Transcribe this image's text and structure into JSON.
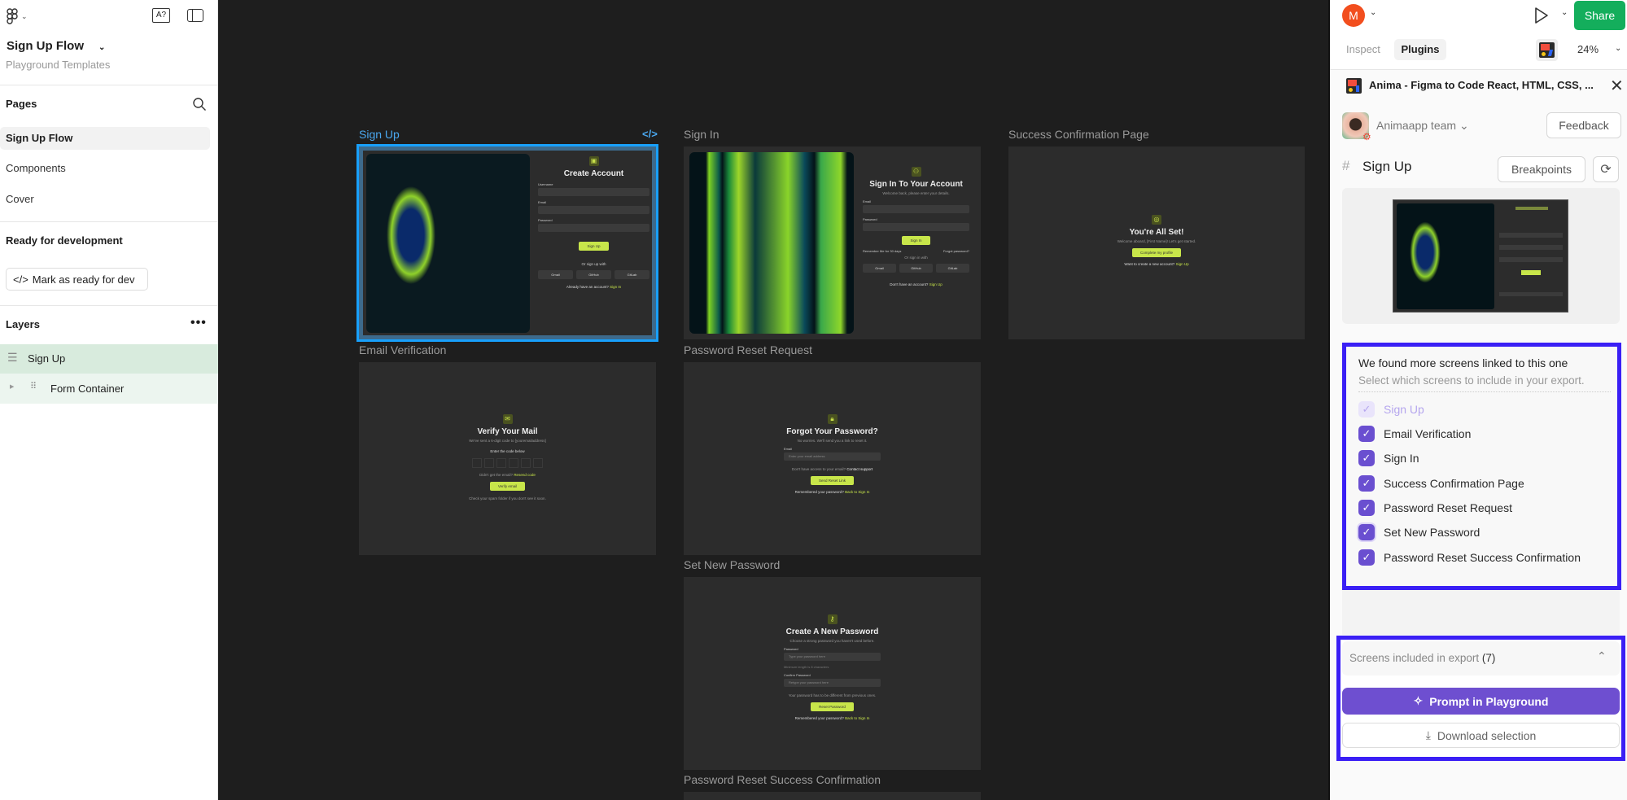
{
  "left": {
    "file_title": "Sign Up Flow",
    "file_subtitle": "Playground Templates",
    "pages_heading": "Pages",
    "pages": [
      {
        "label": "Sign Up Flow",
        "active": true
      },
      {
        "label": "Components"
      },
      {
        "label": "Cover"
      }
    ],
    "ready_heading": "Ready for development",
    "mark_ready_label": "Mark as ready for dev",
    "layers_heading": "Layers",
    "layers": [
      {
        "label": "Sign Up",
        "selected": true
      },
      {
        "label": "Form Container"
      }
    ],
    "text_tool_label": "A?"
  },
  "canvas": {
    "frames": {
      "signup": {
        "label": "Sign Up",
        "title": "Create Account",
        "username": "Username",
        "email": "Email",
        "password": "Password",
        "button": "Sign Up",
        "or": "Or sign up with",
        "social": [
          "Gmail",
          "GitHub",
          "GitLab"
        ],
        "footer": "Already have an account?",
        "footer_link": "Sign In"
      },
      "signin": {
        "label": "Sign In",
        "title": "Sign In To Your Account",
        "subtitle": "Welcome back, please enter your details.",
        "email": "Email",
        "password": "Password",
        "button": "Sign In",
        "remember": "Remember Me for 30 days",
        "forgot": "Forgot password?",
        "or": "Or sign in with",
        "social": [
          "Gmail",
          "GitHub",
          "GitLab"
        ],
        "footer": "Don't have an account?",
        "footer_link": "Sign Up"
      },
      "success": {
        "label": "Success Confirmation Page",
        "title": "You're All Set!",
        "subtitle": "Welcome aboard, [First Name]! Let's get started.",
        "button": "Complete my profile",
        "footer": "Want to create a new account?",
        "footer_link": "Sign Up"
      },
      "email_verification": {
        "label": "Email Verification",
        "title": "Verify Your Mail",
        "subtitle": "We've sent a 6-digit code to [youremailaddress]",
        "code_label": "Enter the code below",
        "resend": "Didn't get the email?",
        "resend_link": "Resend code",
        "button": "Verify email",
        "note": "Check your spam folder if you don't see it soon."
      },
      "reset_request": {
        "label": "Password Reset Request",
        "title": "Forgot Your Password?",
        "subtitle": "No worries. We'll send you a link to reset it.",
        "email": "Email",
        "email_placeholder": "Enter your email address",
        "support": "Don't have access to your email?",
        "support_link": "Contact support",
        "button": "Send Reset Link",
        "footer": "Remembered your password?",
        "footer_link": "Back to Sign In"
      },
      "set_new": {
        "label": "Set New Password",
        "title": "Create A New Password",
        "subtitle": "Choose a strong password you haven't used before.",
        "password": "Password",
        "password_placeholder": "Type your password here",
        "hint": "Minimum length is 8 characters",
        "confirm": "Confirm Password",
        "confirm_placeholder": "Retype your password here",
        "note": "Your password has to be different from previous ones.",
        "button": "Reset Password",
        "footer": "Remembered your password?",
        "footer_link": "Back to Sign In"
      },
      "reset_success": {
        "label": "Password Reset Success Confirmation"
      }
    }
  },
  "right": {
    "avatar_initial": "M",
    "share_label": "Share",
    "tabs": [
      {
        "label": "Inspect"
      },
      {
        "label": "Plugins",
        "active": true
      }
    ],
    "zoom": "24%",
    "plugin": {
      "title": "Anima - Figma to Code React, HTML, CSS, ...",
      "team": "Animaapp team",
      "feedback": "Feedback",
      "frame_name": "Sign Up",
      "breakpoints": "Breakpoints",
      "linked": {
        "heading": "We found more screens linked to this one",
        "subheading": "Select which screens to include in your export.",
        "screens": [
          {
            "label": "Sign Up",
            "checked": true,
            "disabled": true
          },
          {
            "label": "Email Verification",
            "checked": true
          },
          {
            "label": "Sign In",
            "checked": true
          },
          {
            "label": "Success Confirmation Page",
            "checked": true
          },
          {
            "label": "Password Reset Request",
            "checked": true
          },
          {
            "label": "Set New Password",
            "checked": true
          },
          {
            "label": "Password Reset Success Confirmation",
            "checked": true
          }
        ]
      },
      "export_label": "Screens included in export",
      "export_count": "(7)",
      "prompt_button": "Prompt in Playground",
      "download_button": "Download selection"
    }
  },
  "colors": {
    "accent_purple": "#6a4fd0",
    "share_green": "#14ae5c",
    "highlight_blue": "#3a1ff5",
    "lime": "#c8e64a",
    "selection_blue": "#18a0fb"
  }
}
